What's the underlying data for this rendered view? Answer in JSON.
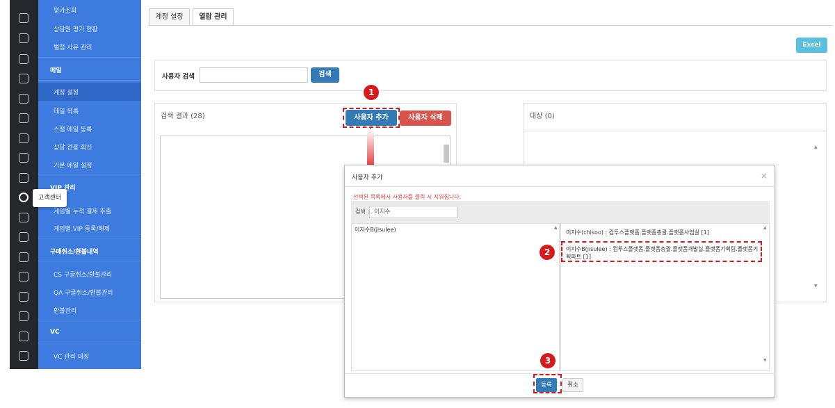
{
  "rail": {
    "icons": [
      "dashboard-icon",
      "document-icon",
      "user-icon",
      "card-icon",
      "edit-icon",
      "plus-box-icon",
      "share-icon",
      "chat-icon",
      "users-icon",
      "headset-icon",
      "chart-icon",
      "shield-icon",
      "database-icon",
      "monitor-icon",
      "refresh-icon",
      "gift-icon",
      "bar-chart-icon",
      "layers-icon"
    ],
    "tooltip": "고객센터"
  },
  "sidebar": {
    "items": [
      {
        "label": "평가조회"
      },
      {
        "label": "상담원 평가 현황"
      },
      {
        "label": "벌점 사유 관리"
      }
    ],
    "mail_section": {
      "heading": "메일",
      "items": [
        "계정 설정",
        "메일 목록",
        "스팸 메일 등록",
        "상담 전용 회신",
        "기본 메일 설정"
      ]
    },
    "vip_section": {
      "heading": "VIP 관리",
      "items": [
        "게임별 누적 결제 추출",
        "게임별 VIP 등록/해제"
      ]
    },
    "refund_section": {
      "heading": "구매취소/환불내역",
      "items": [
        "CS 구글취소/환불관리",
        "QA 구글취소/환불관리",
        "환불관리"
      ]
    },
    "vc_section": {
      "heading": "VC",
      "items": [
        "VC 관리 대장"
      ]
    }
  },
  "tabs": [
    {
      "label": "계정 설정"
    },
    {
      "label": "열람 관리"
    }
  ],
  "toolbar": {
    "excel_label": "Excel"
  },
  "search": {
    "label": "사용자 검색",
    "button": "검색",
    "value": ""
  },
  "results": {
    "title": "검색 결과 (28)",
    "add_button": "사용자 추가",
    "delete_button": "사용자 삭제"
  },
  "target": {
    "title": "대상 (0)"
  },
  "modal": {
    "title": "사용자 추가",
    "notice": "선택된 목록에서 사용자를 클릭 시 지워집니다.",
    "search_label": "검색 :",
    "search_value": "이지수",
    "left_items": [
      "이지수B(jisulee)"
    ],
    "right_items": [
      "이지수(chisoo) : 컴투스플랫폼.플랫폼총괄.플랫폼사업실 [1]",
      "이지수B(jisulee) : 컴투스플랫폼.플랫폼총괄.플랫폼개발실.플랫폼기획팀.플랫폼기획파트 [1]"
    ],
    "register_button": "등록",
    "cancel_button": "취소"
  },
  "markers": [
    "1",
    "2",
    "3"
  ],
  "colors": {
    "sidebar": "#3d7bdf",
    "rail": "#24272c",
    "primary": "#337ab7",
    "danger": "#d9534f",
    "excel": "#5bc0de",
    "marker": "#d7191b"
  }
}
